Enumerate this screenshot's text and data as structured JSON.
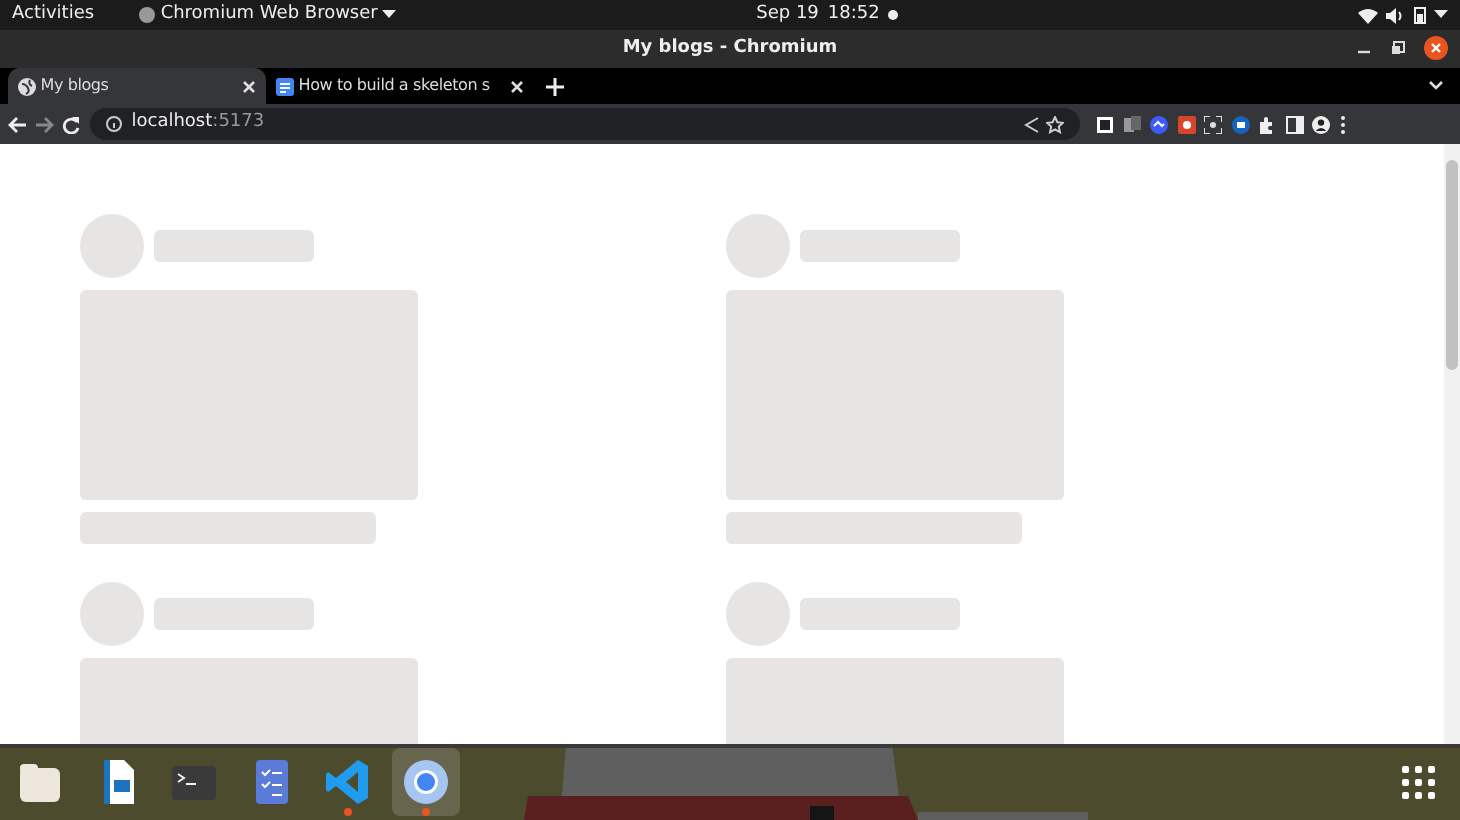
{
  "system_bar": {
    "activities": "Activities",
    "app_menu": "Chromium Web Browser",
    "date": "Sep 19",
    "time": "18:52"
  },
  "window": {
    "title": "My blogs - Chromium"
  },
  "tabs": [
    {
      "label": "My blogs",
      "selected": true,
      "kind": "globe"
    },
    {
      "label": "How to build a skeleton s",
      "selected": false,
      "kind": "doc"
    }
  ],
  "address_bar": {
    "host": "localhost",
    "port": ":5173"
  },
  "page": {
    "cards": [
      {
        "kind": "skeleton",
        "footer": true
      },
      {
        "kind": "skeleton",
        "footer": true
      },
      {
        "kind": "skeleton",
        "footer": false
      },
      {
        "kind": "skeleton",
        "footer": false
      }
    ]
  },
  "dock": {
    "items": [
      {
        "kind": "files",
        "running": false,
        "selected": false
      },
      {
        "kind": "writer",
        "running": false,
        "selected": false
      },
      {
        "kind": "terminal",
        "running": false,
        "selected": false
      },
      {
        "kind": "tasks",
        "running": false,
        "selected": false
      },
      {
        "kind": "vscode",
        "running": true,
        "selected": false
      },
      {
        "kind": "chromium",
        "running": true,
        "selected": true
      }
    ]
  }
}
